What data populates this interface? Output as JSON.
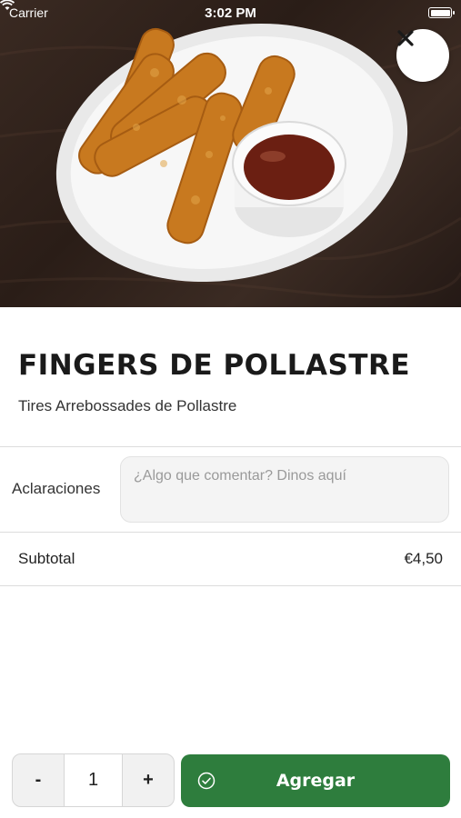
{
  "status_bar": {
    "carrier": "Carrier",
    "time": "3:02 PM"
  },
  "product": {
    "name": "FINGERS DE POLLASTRE",
    "description": "Tires Arrebossades de Pollastre",
    "image_icon": "chicken-fingers-photo"
  },
  "notes": {
    "label": "Aclaraciones",
    "placeholder": "¿Algo que comentar? Dinos aquí",
    "value": ""
  },
  "subtotal": {
    "label": "Subtotal",
    "value": "€4,50"
  },
  "quantity": {
    "decrement_label": "-",
    "value": "1",
    "increment_label": "+"
  },
  "add_button": {
    "label": "Agregar",
    "icon": "check-circle-icon"
  },
  "colors": {
    "accent": "#2e7d3d",
    "divider": "#dcdcdc"
  }
}
